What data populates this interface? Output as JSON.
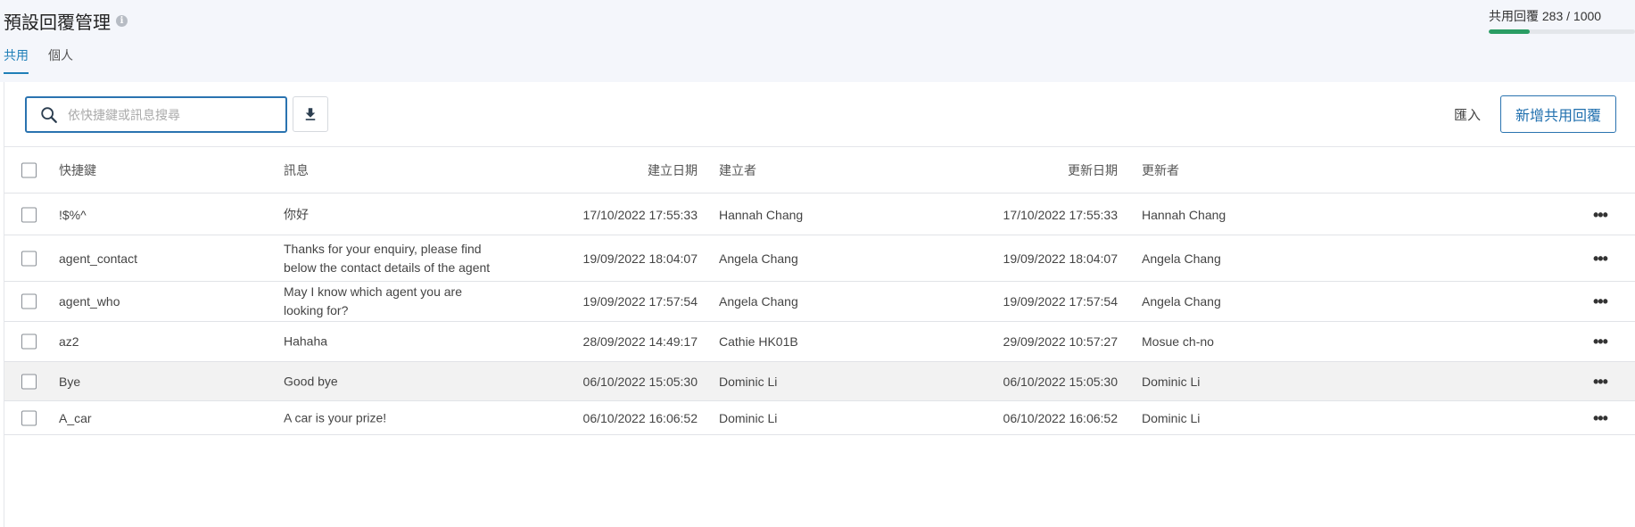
{
  "header": {
    "title": "預設回覆管理",
    "info_icon": "i",
    "tabs": [
      {
        "label": "共用",
        "active": true
      },
      {
        "label": "個人",
        "active": false
      }
    ],
    "quota": {
      "text": "共用回覆 283 / 1000",
      "used": 283,
      "total": 1000,
      "bar_color": "#2a9d64"
    }
  },
  "toolbar": {
    "search_placeholder": "依快捷鍵或訊息搜尋",
    "search_value": "",
    "import_label": "匯入",
    "add_label": "新增共用回覆"
  },
  "table": {
    "columns": {
      "shortcut": "快捷鍵",
      "message": "訊息",
      "created_date": "建立日期",
      "creator": "建立者",
      "updated_date": "更新日期",
      "updater": "更新者"
    },
    "rows": [
      {
        "shortcut": "!$%^",
        "message": "你好",
        "created_date": "17/10/2022 17:55:33",
        "creator": "Hannah Chang",
        "updated_date": "17/10/2022 17:55:33",
        "updater": "Hannah Chang"
      },
      {
        "shortcut": "agent_contact",
        "message": "Thanks for your enquiry, please find below the contact details of the agent",
        "created_date": "19/09/2022 18:04:07",
        "creator": "Angela Chang",
        "updated_date": "19/09/2022 18:04:07",
        "updater": "Angela Chang"
      },
      {
        "shortcut": "agent_who",
        "message": "May I know which agent you are looking for?",
        "created_date": "19/09/2022 17:57:54",
        "creator": "Angela Chang",
        "updated_date": "19/09/2022 17:57:54",
        "updater": "Angela Chang"
      },
      {
        "shortcut": "az2",
        "message": "Hahaha",
        "created_date": "28/09/2022 14:49:17",
        "creator": "Cathie HK01B",
        "updated_date": "29/09/2022 10:57:27",
        "updater": "Mosue ch-no"
      },
      {
        "shortcut": "Bye",
        "message": "Good bye",
        "created_date": "06/10/2022 15:05:30",
        "creator": "Dominic Li",
        "updated_date": "06/10/2022 15:05:30",
        "updater": "Dominic Li"
      },
      {
        "shortcut": "A_car",
        "message": "A car is your prize!",
        "created_date": "06/10/2022 16:06:52",
        "creator": "Dominic Li",
        "updated_date": "06/10/2022 16:06:52",
        "updater": "Dominic Li"
      }
    ],
    "more_icon": "•••"
  }
}
